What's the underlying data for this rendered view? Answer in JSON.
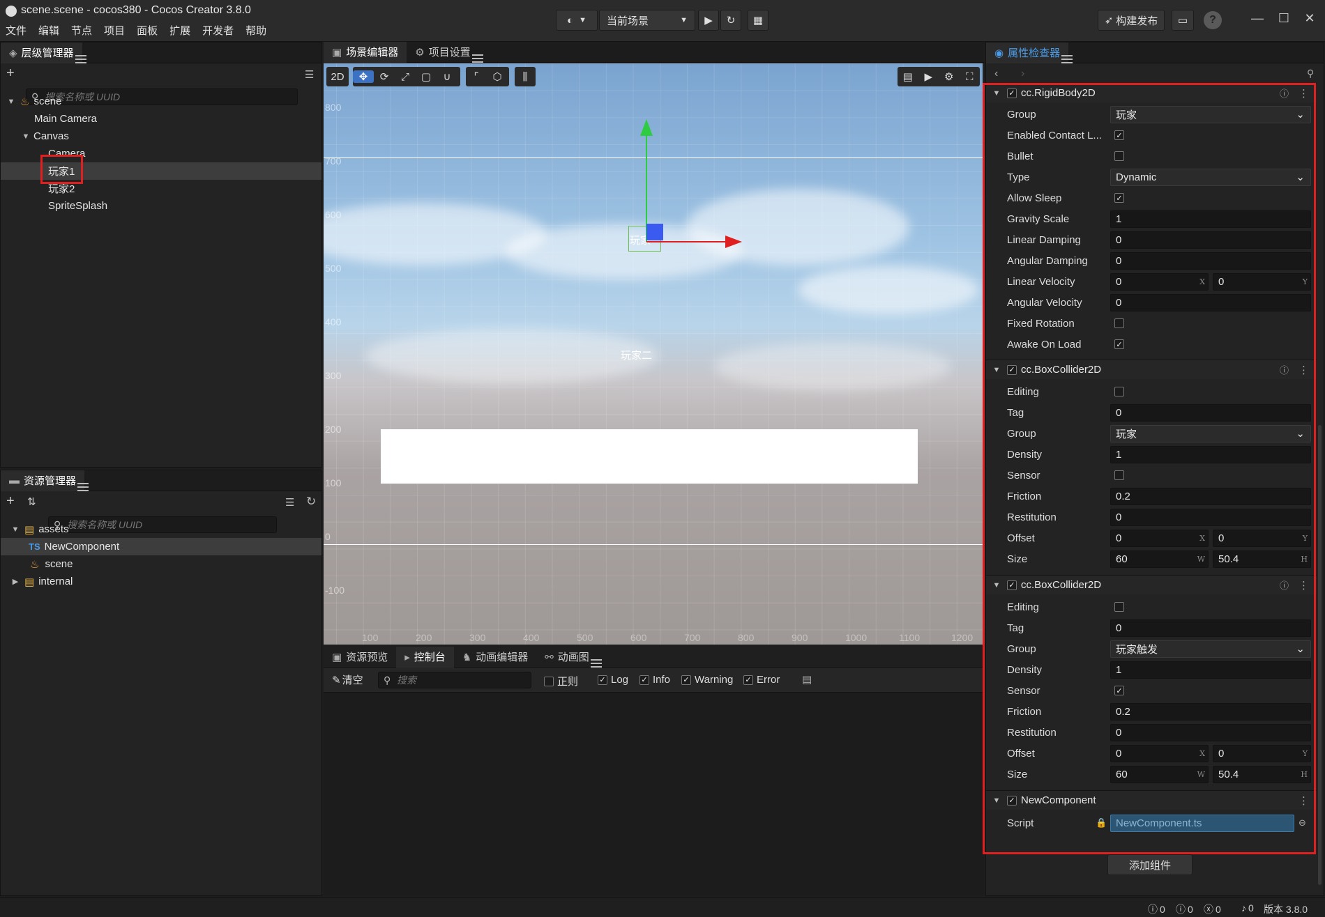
{
  "window": {
    "title": "scene.scene - cocos380 - Cocos Creator 3.8.0",
    "menu": [
      "文件",
      "编辑",
      "节点",
      "项目",
      "面板",
      "扩展",
      "开发者",
      "帮助"
    ],
    "scene_selector": "当前场景",
    "build_publish": "构建发布"
  },
  "hierarchy": {
    "tab": "层级管理器",
    "search_placeholder": "搜索名称或 UUID",
    "nodes": [
      "scene",
      "Main Camera",
      "Canvas",
      "Camera",
      "玩家1",
      "玩家2",
      "SpriteSplash"
    ]
  },
  "assets": {
    "tab": "资源管理器",
    "search_placeholder": "搜索名称或 UUID",
    "items": [
      "assets",
      "NewComponent",
      "scene",
      "internal"
    ],
    "ts_badge": "TS"
  },
  "scene_editor": {
    "tabs": [
      "场景编辑器",
      "项目设置"
    ],
    "mode_2d": "2D",
    "y_ruler": [
      "800",
      "700",
      "600",
      "500",
      "400",
      "300",
      "200",
      "100",
      "0",
      "-100"
    ],
    "x_ruler": [
      "100",
      "200",
      "300",
      "400",
      "500",
      "600",
      "700",
      "800",
      "900",
      "1000",
      "1100",
      "1200"
    ],
    "label_player1": "玩家",
    "label_player2": "玩家二"
  },
  "bottom_panel": {
    "tabs": [
      "资源预览",
      "控制台",
      "动画编辑器",
      "动画图"
    ],
    "clear": "清空",
    "search_placeholder": "搜索",
    "filters": [
      {
        "label": "正则",
        "checked": false
      },
      {
        "label": "Log",
        "checked": true
      },
      {
        "label": "Info",
        "checked": true
      },
      {
        "label": "Warning",
        "checked": true
      },
      {
        "label": "Error",
        "checked": true
      }
    ]
  },
  "inspector": {
    "tab": "属性检查器",
    "components": {
      "rigidbody": {
        "name": "cc.RigidBody2D",
        "group_label": "Group",
        "group": "玩家",
        "ecl_label": "Enabled Contact L...",
        "bullet_label": "Bullet",
        "type_label": "Type",
        "type": "Dynamic",
        "allow_sleep_label": "Allow Sleep",
        "gravity_label": "Gravity Scale",
        "gravity": "1",
        "lin_damp_label": "Linear Damping",
        "lin_damp": "0",
        "ang_damp_label": "Angular Damping",
        "ang_damp": "0",
        "lin_vel_label": "Linear Velocity",
        "lin_vel_x": "0",
        "lin_vel_y": "0",
        "ang_vel_label": "Angular Velocity",
        "ang_vel": "0",
        "fixed_rot_label": "Fixed Rotation",
        "awake_label": "Awake On Load"
      },
      "box1": {
        "name": "cc.BoxCollider2D",
        "editing_label": "Editing",
        "tag_label": "Tag",
        "tag": "0",
        "group_label": "Group",
        "group": "玩家",
        "density_label": "Density",
        "density": "1",
        "sensor_label": "Sensor",
        "friction_label": "Friction",
        "friction": "0.2",
        "restitution_label": "Restitution",
        "restitution": "0",
        "offset_label": "Offset",
        "offset_x": "0",
        "offset_y": "0",
        "size_label": "Size",
        "size_w": "60",
        "size_h": "50.4"
      },
      "box2": {
        "name": "cc.BoxCollider2D",
        "editing_label": "Editing",
        "tag_label": "Tag",
        "tag": "0",
        "group_label": "Group",
        "group": "玩家触发",
        "density_label": "Density",
        "density": "1",
        "sensor_label": "Sensor",
        "friction_label": "Friction",
        "friction": "0.2",
        "restitution_label": "Restitution",
        "restitution": "0",
        "offset_label": "Offset",
        "offset_x": "0",
        "offset_y": "0",
        "size_label": "Size",
        "size_w": "60",
        "size_h": "50.4"
      },
      "newcomp": {
        "name": "NewComponent",
        "script_label": "Script",
        "script": "NewComponent.ts"
      }
    },
    "axis": {
      "x": "X",
      "y": "Y",
      "w": "W",
      "h": "H"
    },
    "add_component": "添加组件"
  },
  "statusbar": {
    "info": "0",
    "warn": "0",
    "error": "0",
    "notify": "0",
    "version": "版本 3.8.0"
  },
  "colors": {
    "accent": "#3c72c4",
    "highlight_box": "#e02020",
    "panel": "#232323"
  }
}
